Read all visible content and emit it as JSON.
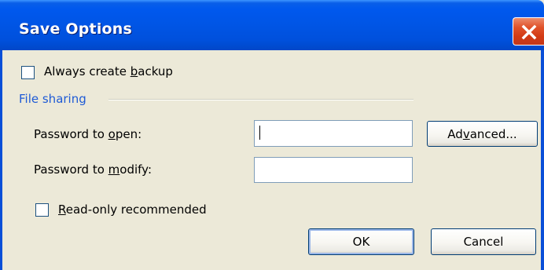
{
  "window": {
    "title": "Save Options"
  },
  "backup": {
    "label_before": "Always create ",
    "label_accel": "b",
    "label_after": "ackup",
    "checked": false
  },
  "file_sharing": {
    "group_label": "File sharing",
    "password_open": {
      "label_before": "Password to ",
      "label_accel": "o",
      "label_after": "pen:",
      "value": ""
    },
    "password_modify": {
      "label_before": "Password to ",
      "label_accel": "m",
      "label_after": "odify:",
      "value": ""
    },
    "advanced": {
      "label_before": "Ad",
      "label_accel": "v",
      "label_after": "anced..."
    },
    "readonly": {
      "label_accel": "R",
      "label_after": "ead-only recommended",
      "checked": false
    }
  },
  "buttons": {
    "ok_label": "OK",
    "cancel_label": "Cancel"
  },
  "colors": {
    "titlebar": "#0055e5",
    "dialog_face": "#ece9d8",
    "group_label": "#1f5bd6",
    "close_button": "#d23a14"
  }
}
